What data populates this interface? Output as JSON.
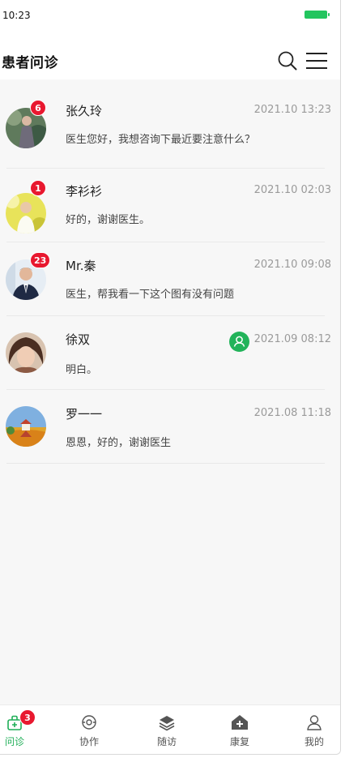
{
  "status_bar": {
    "time": "10:23",
    "battery_color": "#22c55e"
  },
  "header": {
    "title": "患者问诊",
    "search_icon": "search-icon",
    "menu_icon": "menu-icon"
  },
  "conversations": [
    {
      "name": "张久玲",
      "time": "2021.10 13:23",
      "message": "医生您好，我想咨询下最近要注意什么？",
      "unread": "6",
      "avatar": "woman-outdoor-photo"
    },
    {
      "name": "李衫衫",
      "time": "2021.10 02:03",
      "message": "好的，谢谢医生。",
      "unread": "1",
      "avatar": "woman-yellow-photo"
    },
    {
      "name": "Mr.秦",
      "time": "2021.10 09:08",
      "message": "医生，帮我看一下这个图有没有问题",
      "unread": "23",
      "avatar": "man-suit-photo"
    },
    {
      "name": "徐双",
      "time": "2021.09 08:12",
      "message": "明白。",
      "follow_icon": "user-follow-icon",
      "avatar": "woman-portrait-photo"
    },
    {
      "name": "罗一一",
      "time": "2021.08 11:18",
      "message": "恩恩，好的，谢谢医生",
      "avatar": "landscape-photo"
    }
  ],
  "tabbar": {
    "active_color": "#1fae57",
    "tabs": [
      {
        "label": "问诊",
        "icon": "medical-kit-icon",
        "badge": "3",
        "active": true
      },
      {
        "label": "协作",
        "icon": "collaboration-icon"
      },
      {
        "label": "随访",
        "icon": "layers-icon"
      },
      {
        "label": "康复",
        "icon": "home-plus-icon"
      },
      {
        "label": "我的",
        "icon": "user-icon"
      }
    ]
  }
}
